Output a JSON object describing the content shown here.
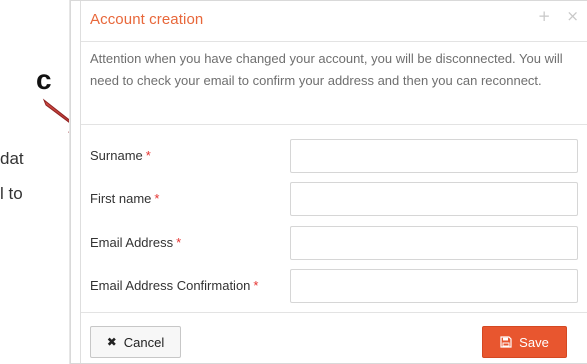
{
  "background": {
    "letter": "c",
    "line_1": "dat",
    "line_2": "l to"
  },
  "modal": {
    "title": "Account creation",
    "icons": {
      "expand": "plus-icon",
      "close": "close-icon"
    },
    "notice": "Attention when you have changed your account, you will be disconnected. You will need to check your email to confirm your address and then you can reconnect.",
    "fields": [
      {
        "label": "Surname",
        "required_mark": "*",
        "value": "",
        "placeholder": ""
      },
      {
        "label": "First name",
        "required_mark": "*",
        "value": "",
        "placeholder": ""
      },
      {
        "label": "Email Address",
        "required_mark": "*",
        "value": "",
        "placeholder": ""
      },
      {
        "label": "Email Address Confirmation",
        "required_mark": "*",
        "value": "",
        "placeholder": ""
      }
    ],
    "buttons": {
      "cancel_label": "Cancel",
      "cancel_icon": "x-icon",
      "save_label": "Save",
      "save_icon": "floppy-disk-icon"
    }
  },
  "colors": {
    "accent": "#E8673A",
    "save_button": "#E8562F",
    "required_mark": "#E5322F",
    "arrow": "#B7352F"
  }
}
